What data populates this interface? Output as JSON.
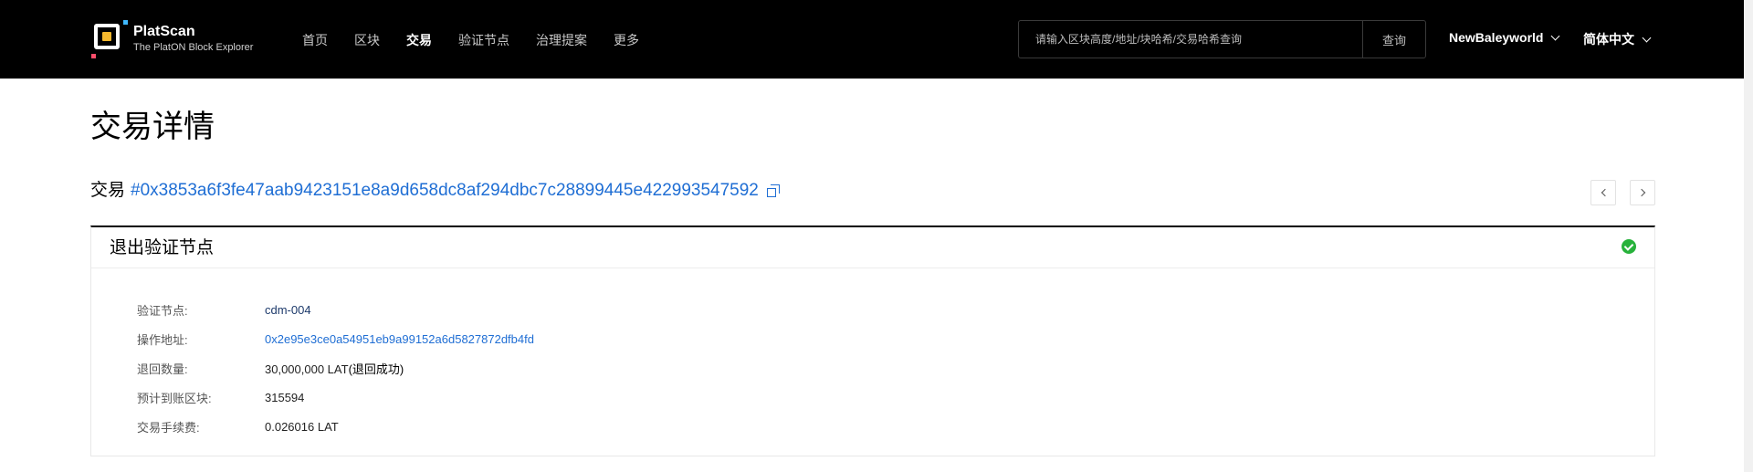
{
  "header": {
    "brand_name": "PlatScan",
    "brand_sub": "The PlatON Block Explorer",
    "nav": [
      "首页",
      "区块",
      "交易",
      "验证节点",
      "治理提案",
      "更多"
    ],
    "active_nav": "交易",
    "search": {
      "placeholder": "请输入区块高度/地址/块哈希/交易哈希查询",
      "button_label": "查询"
    },
    "network": "NewBaleyworld",
    "language": "简体中文"
  },
  "page": {
    "title": "交易详情",
    "tx_label": "交易",
    "tx_hash": "#0x3853a6f3fe47aab9423151e8a9d658dc8af294dbc7c28899445e422993547592"
  },
  "card": {
    "title": "退出验证节点",
    "status": "success",
    "rows": [
      {
        "key": "验证节点:",
        "value": "cdm-004"
      },
      {
        "key": "操作地址:",
        "value": "0x2e95e3ce0a54951eb9a99152a6d5827872dfb4fd"
      },
      {
        "key": "退回数量:",
        "value": "30,000,000 LAT",
        "status_note": "(退回成功)"
      },
      {
        "key": "预计到账区块:",
        "value": "315594"
      },
      {
        "key": "交易手续费:",
        "value": "0.026016 LAT"
      }
    ]
  },
  "colors": {
    "header_bg": "#000000",
    "link": "#1f6ed4",
    "success": "#27b23b",
    "logo_accent": "#f5b82e"
  }
}
